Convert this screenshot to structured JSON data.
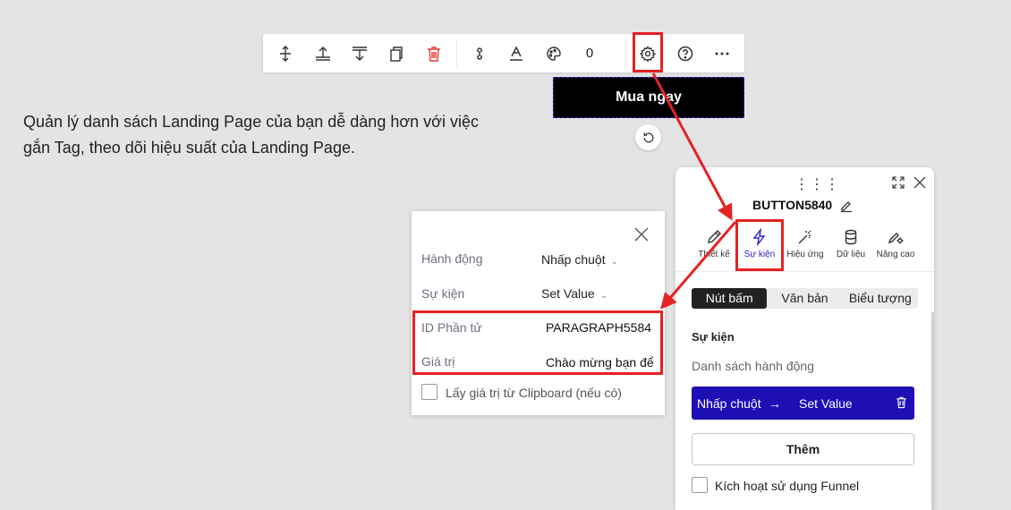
{
  "toolbar": {
    "count": "0",
    "icons": [
      "move-vertical-icon",
      "align-top-icon",
      "align-bottom-icon",
      "duplicate-icon",
      "trash-icon",
      "link-icon",
      "text-color-icon",
      "palette-icon",
      "gear-icon",
      "help-icon",
      "more-icon"
    ]
  },
  "canvas": {
    "button_text": "Mua ngay",
    "paragraph": "Quản lý danh sách Landing Page của bạn dễ dàng hơn với việc gắn Tag, theo dõi hiệu suất của Landing Page."
  },
  "event_popup": {
    "action_label": "Hành động",
    "action_value": "Nhấp chuột",
    "event_label": "Sự kiện",
    "event_value": "Set Value",
    "element_id_label": "ID Phần tử",
    "element_id_value": "PARAGRAPH5584",
    "value_label": "Giá trị",
    "value_value": "Chào mừng bạn để",
    "clipboard_label": "Lấy giá trị từ Clipboard (nếu có)"
  },
  "panel": {
    "title": "BUTTON5840",
    "tabs": [
      {
        "label": "Thiết kế",
        "icon": "pencil-icon"
      },
      {
        "label": "Sự kiện",
        "icon": "lightning-icon"
      },
      {
        "label": "Hiệu ứng",
        "icon": "magic-wand-icon"
      },
      {
        "label": "Dữ liệu",
        "icon": "database-icon"
      },
      {
        "label": "Nâng cao",
        "icon": "advanced-icon"
      }
    ],
    "segments": [
      "Nút bấm",
      "Văn bản",
      "Biểu tượng"
    ],
    "section_title": "Sự kiện",
    "section_subtitle": "Danh sách hành động",
    "action_trigger": "Nhấp chuột",
    "action_arrow": "→",
    "action_event": "Set Value",
    "add_button": "Thêm",
    "funnel_label": "Kích hoạt sử dụng Funnel"
  },
  "colors": {
    "annotation_red": "#e52222",
    "accent_blue": "#1e0fb5",
    "delete_red": "#e53935"
  }
}
